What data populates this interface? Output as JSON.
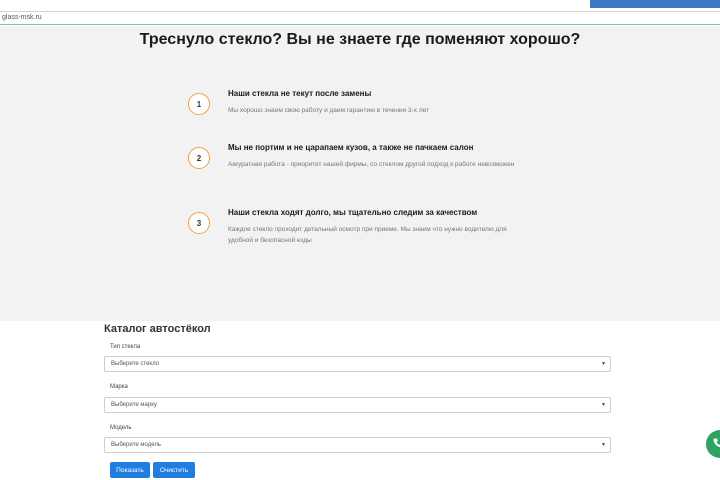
{
  "browser": {
    "url": "glass-msk.ru"
  },
  "hero": {
    "title": "Треснуло стекло? Вы не знаете где поменяют хорошо?",
    "features": [
      {
        "number": "1",
        "title": "Наши стекла не текут после замены",
        "desc": "Мы хорошо знаем свою работу и даем гарантию в течении 3-х лет"
      },
      {
        "number": "2",
        "title": "Мы не портим и не царапаем кузов, а также не пачкаем салон",
        "desc": "Аккуратная работа - приоритет нашей фирмы, со стеклом другой подход к работе невозможен"
      },
      {
        "number": "3",
        "title": "Наши стекла ходят долго, мы тщательно следим за качеством",
        "desc": "Каждое стекло проходит детальный осмотр при приеме. Мы знаем что нужно водителю для удобной и безопасной езды"
      }
    ]
  },
  "catalog": {
    "title": "Каталог автостёкол",
    "fields": [
      {
        "label": "Тип стекла",
        "value": "Выберите стекло"
      },
      {
        "label": "Марка",
        "value": "Выберите марку"
      },
      {
        "label": "Модель",
        "value": "Выберите модель"
      }
    ],
    "show_label": "Показать",
    "clear_label": "Очистить"
  },
  "colors": {
    "accent": "#1f7ee0",
    "circle_border": "#f0a04a",
    "chat_button": "#2fa360"
  },
  "icons": {
    "select_arrow": "caret-down-icon",
    "fab": "phone-icon"
  }
}
